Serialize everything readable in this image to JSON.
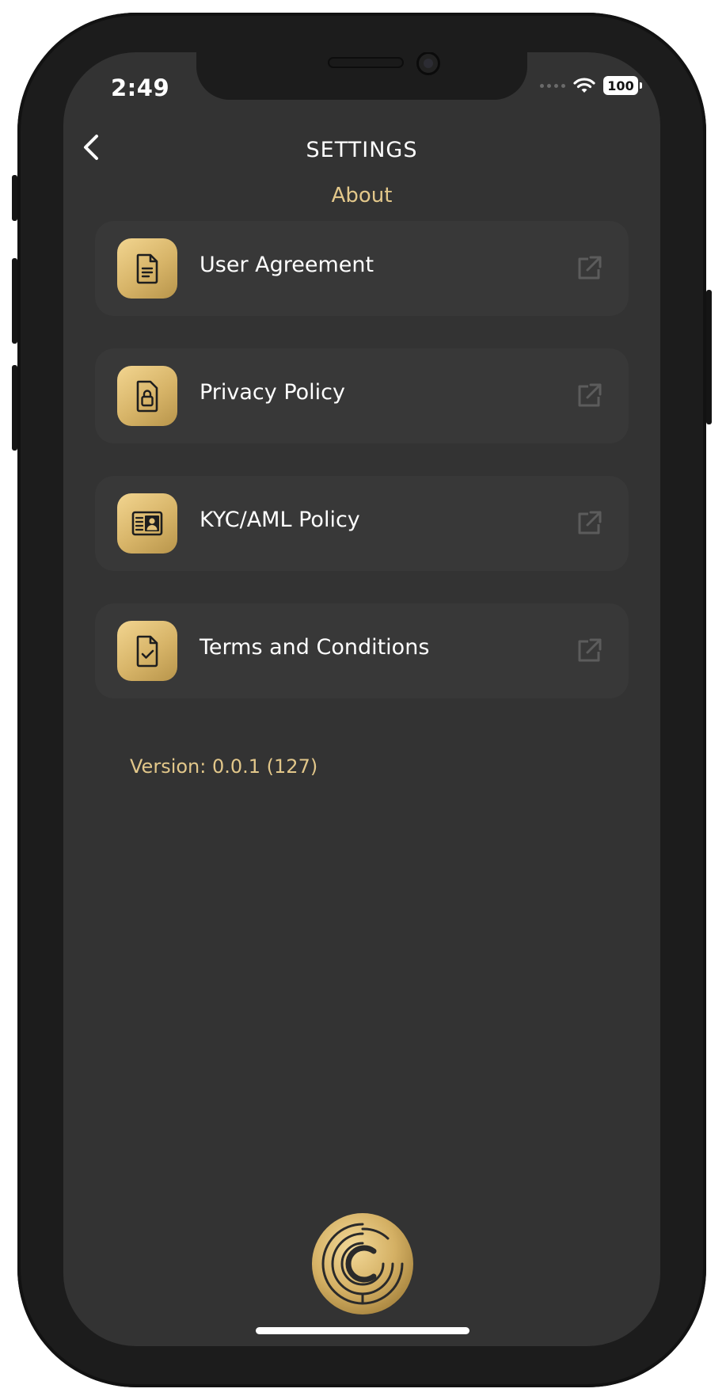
{
  "status_bar": {
    "time": "2:49",
    "battery": "100"
  },
  "nav": {
    "back_icon": "chevron-left-icon",
    "title": "SETTINGS"
  },
  "section_title": "About",
  "items": [
    {
      "label": "User Agreement",
      "icon": "document-icon",
      "action_icon": "external-link-icon"
    },
    {
      "label": "Privacy Policy",
      "icon": "lock-document-icon",
      "action_icon": "external-link-icon"
    },
    {
      "label": "KYC/AML Policy",
      "icon": "id-card-icon",
      "action_icon": "external-link-icon"
    },
    {
      "label": "Terms and Conditions",
      "icon": "document-check-icon",
      "action_icon": "external-link-icon"
    }
  ],
  "version": "Version: 0.0.1 (127)",
  "colors": {
    "background": "#333333",
    "card": "#383838",
    "accent_gold": "#e2c78a",
    "icon_gold": "#d7b468",
    "frame": "#1c1c1c"
  }
}
